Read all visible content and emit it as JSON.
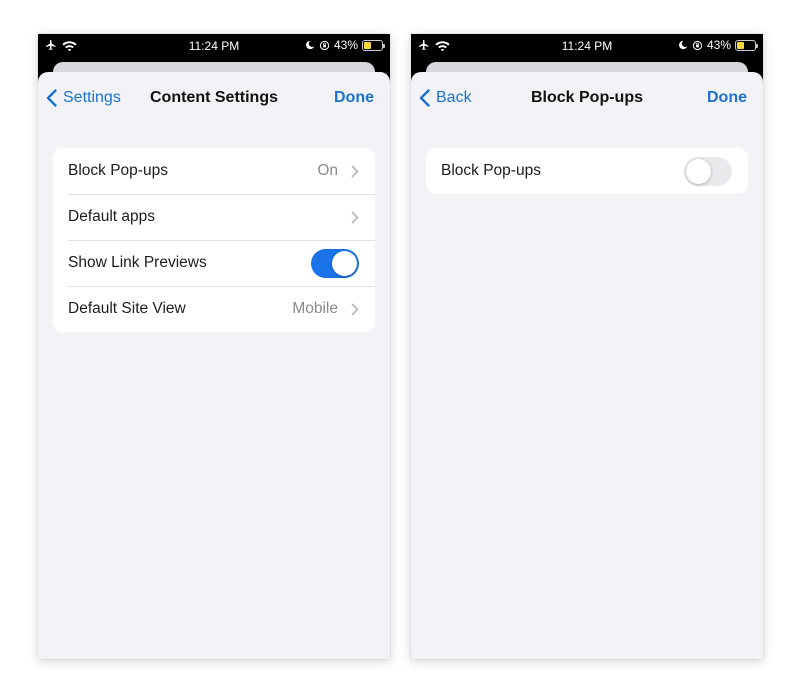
{
  "status_bar": {
    "time": "11:24 PM",
    "battery_percent": "43%",
    "battery_level": 0.43,
    "icons": [
      "airplane-icon",
      "wifi-icon",
      "moon-icon",
      "orientation-lock-icon",
      "battery-icon"
    ]
  },
  "colors": {
    "accent": "#1a73cf",
    "toggle_on": "#1a73e8",
    "background": "#f2f2f7",
    "battery_fill": "#f7d83a"
  },
  "left_screen": {
    "nav": {
      "back_label": "Settings",
      "title": "Content Settings",
      "done_label": "Done"
    },
    "rows": [
      {
        "label": "Block Pop-ups",
        "value": "On",
        "accessory": "chevron"
      },
      {
        "label": "Default apps",
        "value": "",
        "accessory": "chevron"
      },
      {
        "label": "Show Link Previews",
        "toggle": "on"
      },
      {
        "label": "Default Site View",
        "value": "Mobile",
        "accessory": "chevron"
      }
    ]
  },
  "right_screen": {
    "nav": {
      "back_label": "Back",
      "title": "Block Pop-ups",
      "done_label": "Done"
    },
    "rows": [
      {
        "label": "Block Pop-ups",
        "toggle": "off"
      }
    ]
  }
}
